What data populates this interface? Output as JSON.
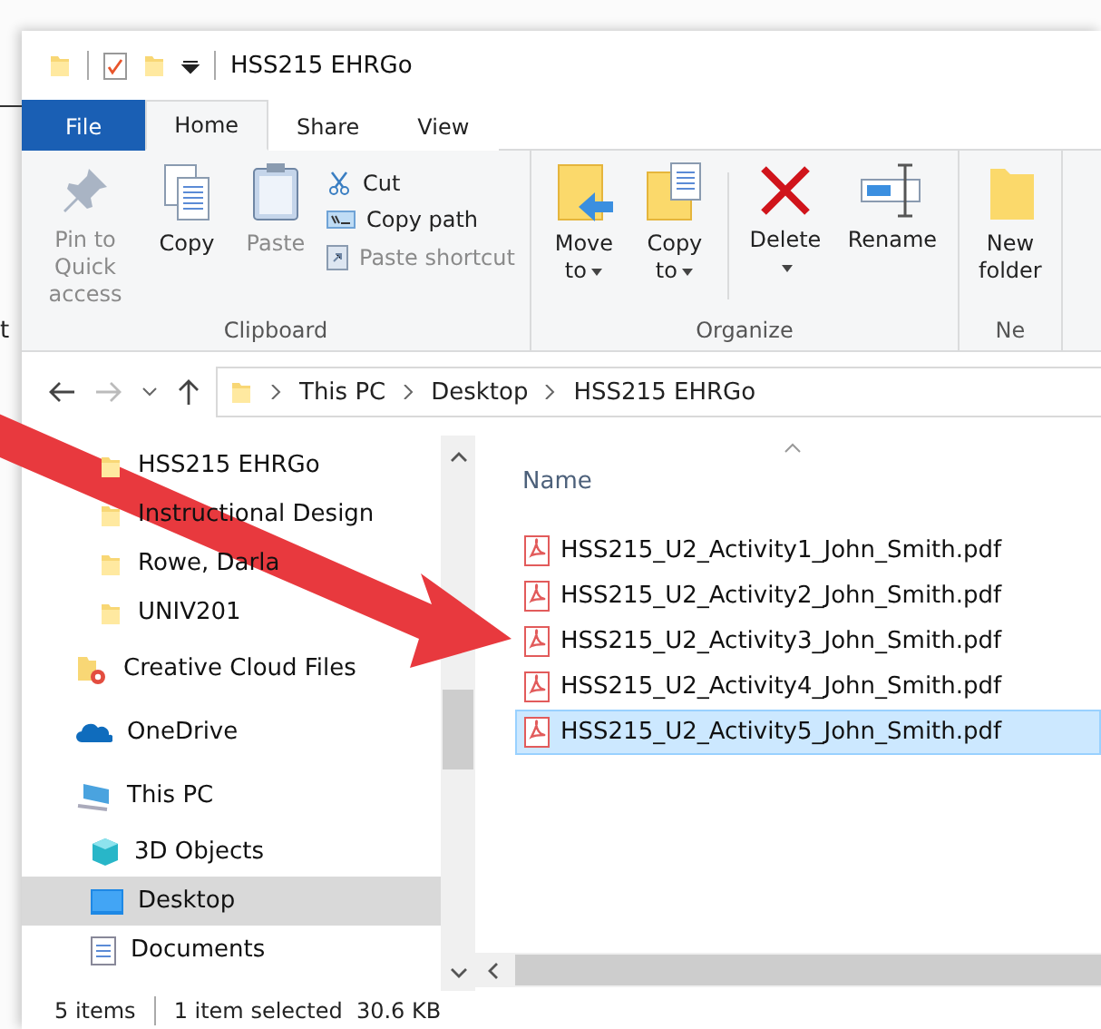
{
  "background_window": {
    "text": "t"
  },
  "title_bar": {
    "title": "HSS215 EHRGo"
  },
  "ribbon": {
    "tabs": [
      {
        "label": "File",
        "kind": "file",
        "selected": false
      },
      {
        "label": "Home",
        "kind": "tab",
        "selected": true
      },
      {
        "label": "Share",
        "kind": "tab",
        "selected": false
      },
      {
        "label": "View",
        "kind": "tab",
        "selected": false
      }
    ],
    "groups": [
      {
        "label": "Clipboard",
        "large": [
          {
            "label": "Pin to Quick access",
            "arrow": false,
            "disabled": true
          },
          {
            "label": "Copy",
            "arrow": false,
            "disabled": false
          },
          {
            "label": "Paste",
            "arrow": false,
            "disabled": true
          }
        ],
        "small": [
          {
            "label": "Cut",
            "disabled": false
          },
          {
            "label": "Copy path",
            "disabled": false
          },
          {
            "label": "Paste shortcut",
            "disabled": true
          }
        ]
      },
      {
        "label": "Organize",
        "large": [
          {
            "label": "Move to",
            "arrow": true,
            "disabled": false
          },
          {
            "label": "Copy to",
            "arrow": true,
            "disabled": false
          },
          {
            "label": "Delete",
            "arrow": true,
            "disabled": false
          },
          {
            "label": "Rename",
            "arrow": false,
            "disabled": false
          }
        ]
      },
      {
        "label": "Ne",
        "large": [
          {
            "label": "New folder",
            "arrow": false,
            "disabled": false
          }
        ]
      }
    ]
  },
  "address_bar": {
    "path": [
      "This PC",
      "Desktop",
      "HSS215 EHRGo"
    ]
  },
  "navigation": [
    {
      "label": "HSS215 EHRGo",
      "kind": "pinned",
      "selected": false
    },
    {
      "label": "Instructional Design",
      "kind": "pinned",
      "selected": false
    },
    {
      "label": "Rowe, Darla",
      "kind": "pinned",
      "selected": false
    },
    {
      "label": "UNIV201",
      "kind": "pinned",
      "selected": false
    },
    {
      "label": "Creative Cloud Files",
      "kind": "cloud-folder",
      "selected": false
    },
    {
      "label": "OneDrive",
      "kind": "onedrive",
      "selected": false
    },
    {
      "label": "This PC",
      "kind": "pc",
      "selected": false,
      "children": [
        {
          "label": "3D Objects",
          "kind": "objects",
          "selected": false
        },
        {
          "label": "Desktop",
          "kind": "desktop",
          "selected": true
        },
        {
          "label": "Documents",
          "kind": "documents",
          "selected": false
        }
      ]
    }
  ],
  "file_list": {
    "columns": [
      "Name"
    ],
    "rows": [
      {
        "name": "HSS215_U2_Activity1_John_Smith.pdf",
        "selected": false
      },
      {
        "name": "HSS215_U2_Activity2_John_Smith.pdf",
        "selected": false
      },
      {
        "name": "HSS215_U2_Activity3_John_Smith.pdf",
        "selected": false
      },
      {
        "name": "HSS215_U2_Activity4_John_Smith.pdf",
        "selected": false
      },
      {
        "name": "HSS215_U2_Activity5_John_Smith.pdf",
        "selected": true
      }
    ]
  },
  "status_bar": {
    "count": "5 items",
    "selection": "1 item selected  30.6 KB"
  }
}
